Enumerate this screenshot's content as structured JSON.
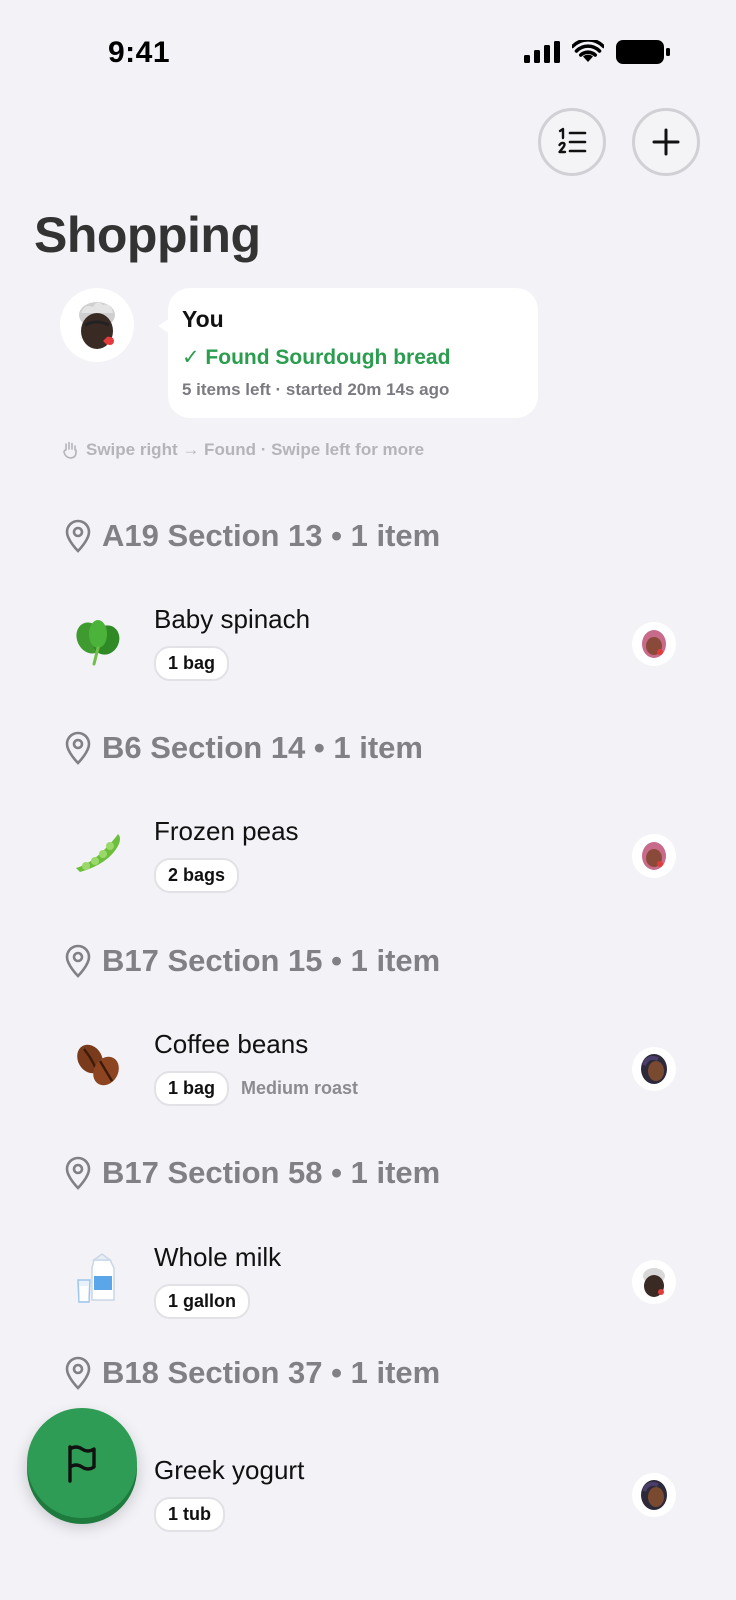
{
  "status_bar": {
    "time": "9:41"
  },
  "toolbar": {
    "list_icon": "numbered-list-icon",
    "add_icon": "plus-icon"
  },
  "page": {
    "title": "Shopping"
  },
  "activity": {
    "name": "You",
    "status": "✓ Found Sourdough bread",
    "meta": "5 items left · started 20m 14s ago"
  },
  "hint": {
    "text": "Swipe right → Found · Swipe left for more"
  },
  "colors": {
    "accent_green": "#2e9c54",
    "found_green": "#2a9d4e",
    "background": "#f2f2f7"
  },
  "sections": [
    {
      "header": "A19 Section 13 • 1 item",
      "items": [
        {
          "name": "Baby spinach",
          "qty": "1 bag",
          "note": "",
          "icon": "spinach-icon",
          "assignee": "avatar-pink"
        }
      ]
    },
    {
      "header": "B6 Section 14 • 1 item",
      "items": [
        {
          "name": "Frozen peas",
          "qty": "2 bags",
          "note": "",
          "icon": "peas-icon",
          "assignee": "avatar-pink"
        }
      ]
    },
    {
      "header": "B17 Section 15 • 1 item",
      "items": [
        {
          "name": "Coffee beans",
          "qty": "1 bag",
          "note": "Medium roast",
          "icon": "coffee-beans-icon",
          "assignee": "avatar-dark"
        }
      ]
    },
    {
      "header": "B17 Section 58 • 1 item",
      "items": [
        {
          "name": "Whole milk",
          "qty": "1 gallon",
          "note": "",
          "icon": "milk-icon",
          "assignee": "avatar-you"
        }
      ]
    },
    {
      "header": "B18 Section 37 • 1 item",
      "items": [
        {
          "name": "Greek yogurt",
          "qty": "1 tub",
          "note": "",
          "icon": "yogurt-icon",
          "assignee": "avatar-dark"
        }
      ]
    }
  ],
  "fab": {
    "icon": "flag-icon"
  }
}
